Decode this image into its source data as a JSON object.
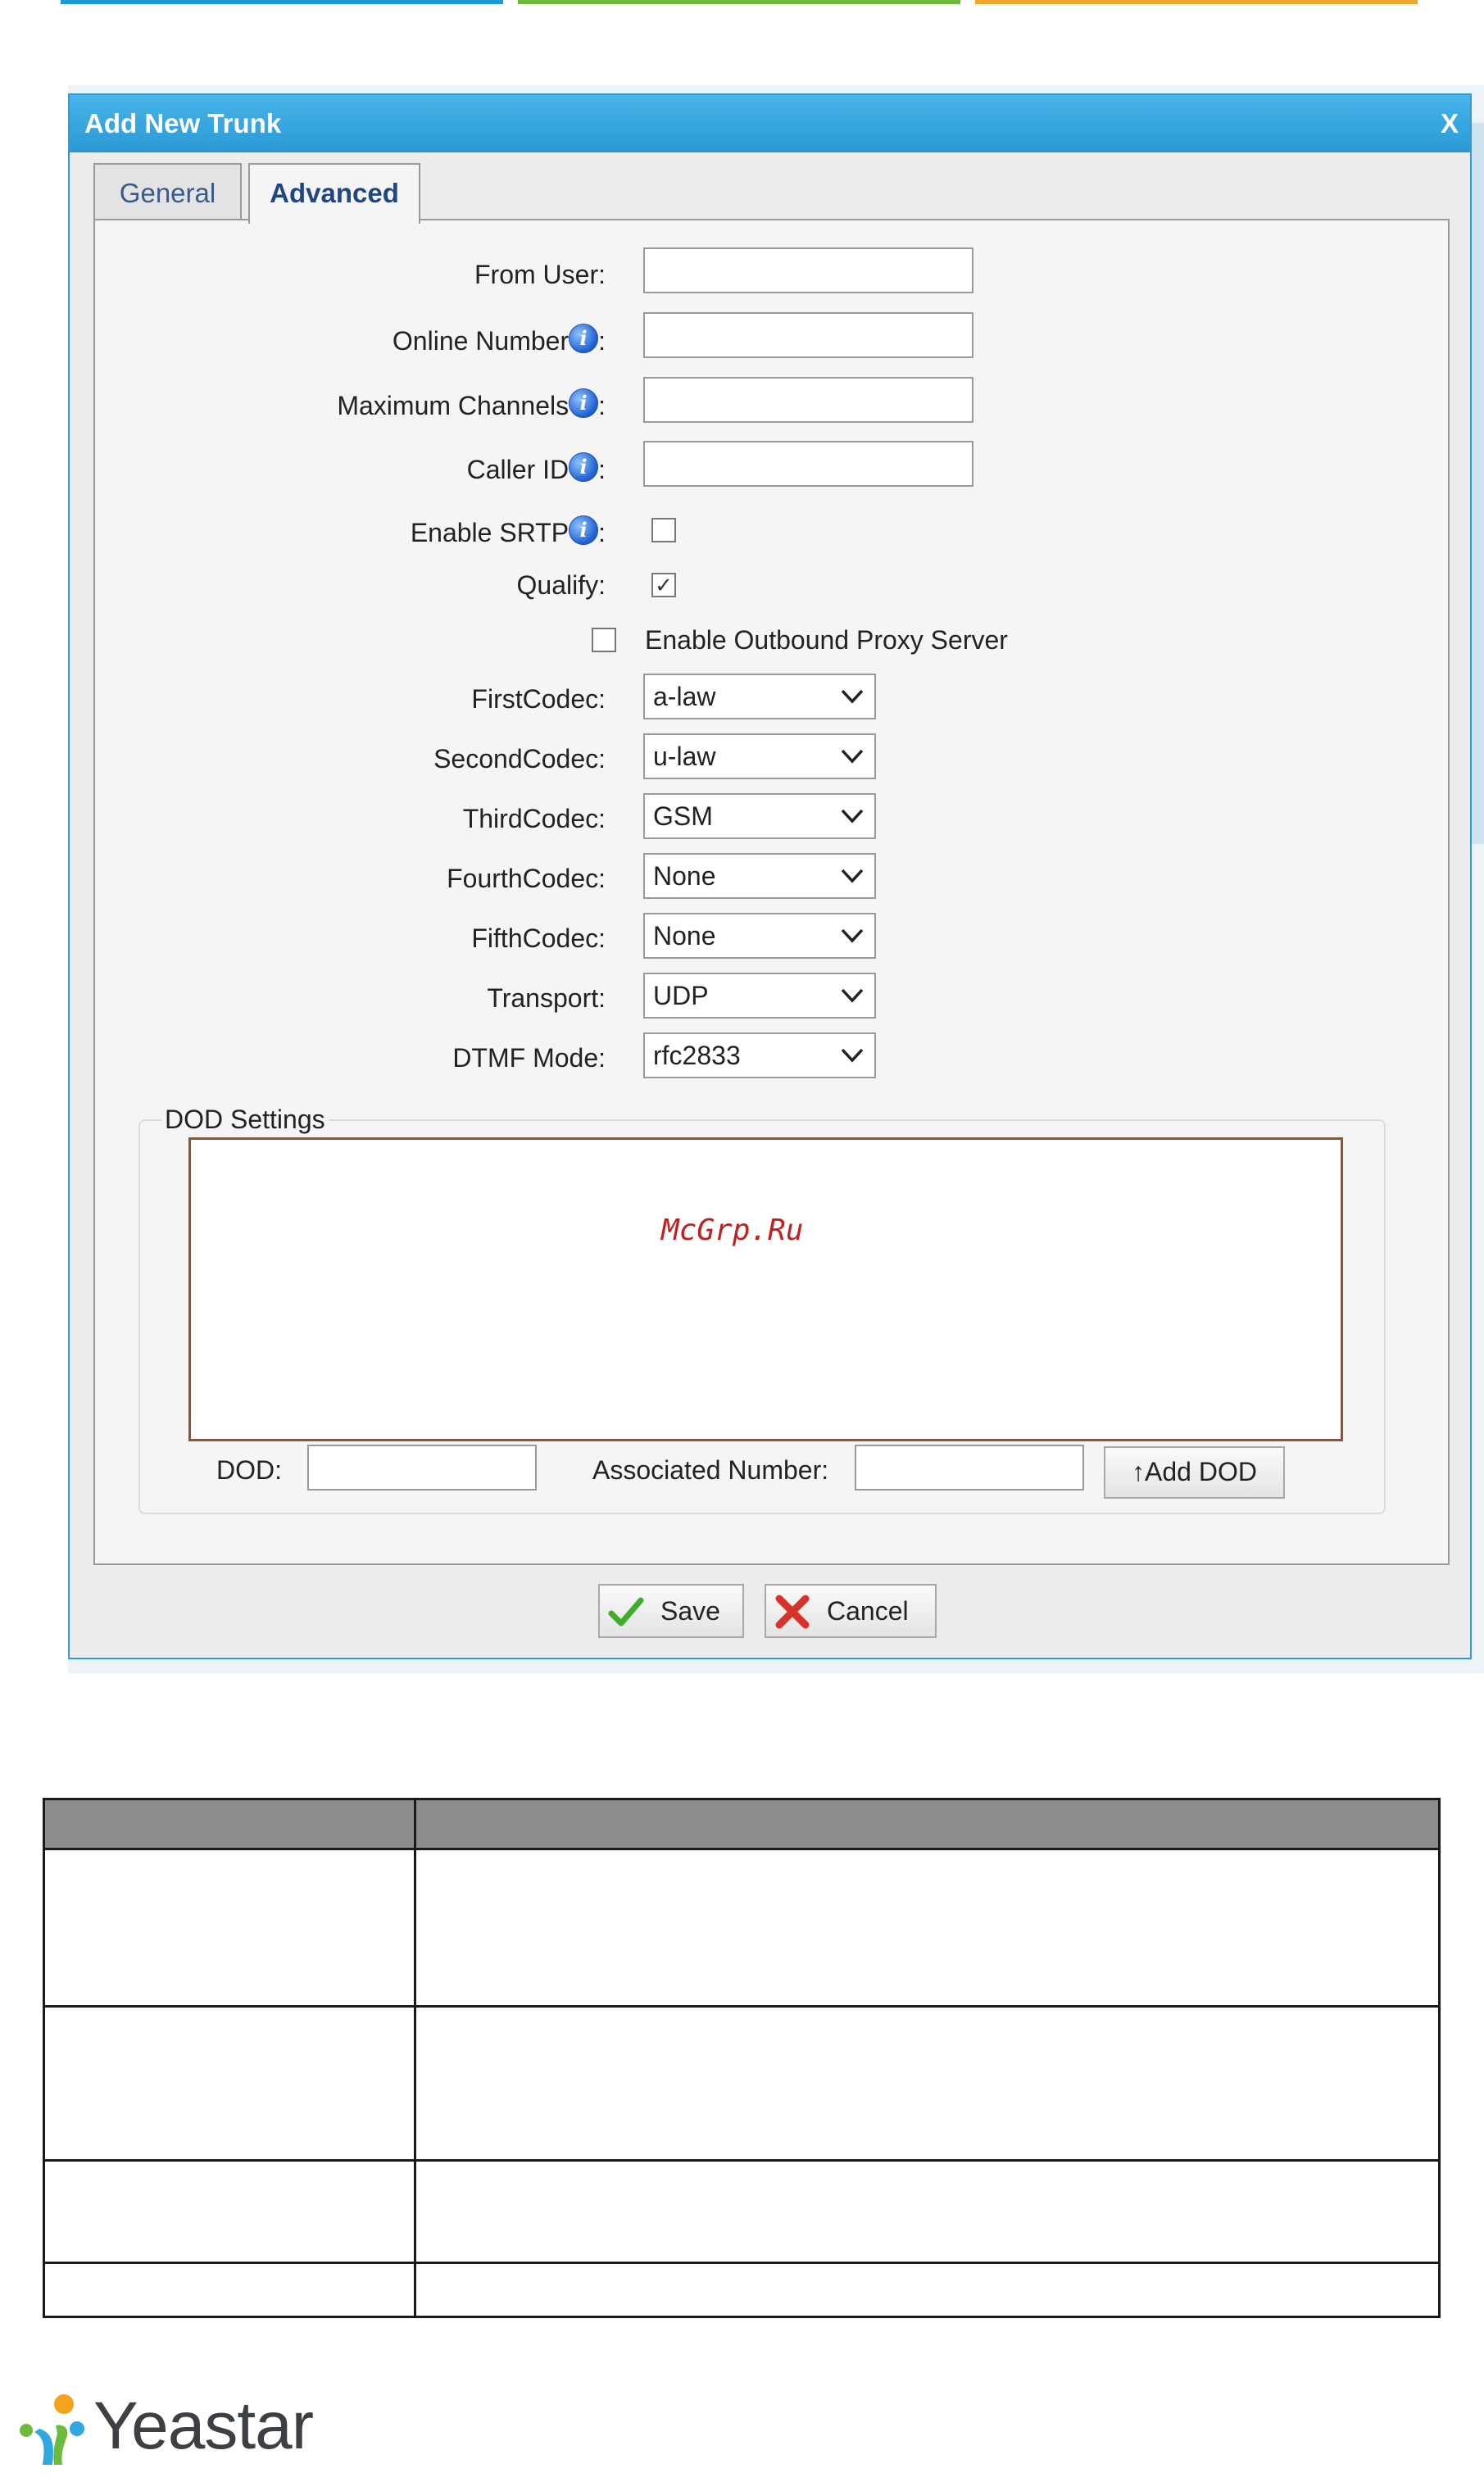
{
  "colors": {
    "strip_1": "#1b9ad6",
    "strip_2": "#6cbb3c",
    "strip_3": "#f3a529",
    "titlebar": "#3aa7df",
    "table_header": "#8c8c8c",
    "watermark": "#c41e1e"
  },
  "dialog": {
    "title": "Add New Trunk",
    "close_label": "X",
    "tabs": [
      {
        "label": "General",
        "active": false
      },
      {
        "label": "Advanced",
        "active": true
      }
    ],
    "fields": {
      "from_user": {
        "label": "From User:",
        "value": ""
      },
      "online_number": {
        "label": "Online Number",
        "suffix": ":",
        "value": "",
        "icon": "info-icon"
      },
      "max_channels": {
        "label": "Maximum Channels",
        "suffix": ":",
        "value": "",
        "icon": "info-icon"
      },
      "caller_id": {
        "label": "Caller ID",
        "suffix": ":",
        "value": "",
        "icon": "info-icon"
      },
      "enable_srtp": {
        "label": "Enable SRTP",
        "suffix": ":",
        "checked": false,
        "icon": "info-icon"
      },
      "qualify": {
        "label": "Qualify:",
        "checked": true
      },
      "outbound_proxy": {
        "label": "Enable Outbound Proxy Server",
        "checked": false
      },
      "first_codec": {
        "label": "FirstCodec:",
        "value": "a-law"
      },
      "second_codec": {
        "label": "SecondCodec:",
        "value": "u-law"
      },
      "third_codec": {
        "label": "ThirdCodec:",
        "value": "GSM"
      },
      "fourth_codec": {
        "label": "FourthCodec:",
        "value": "None"
      },
      "fifth_codec": {
        "label": "FifthCodec:",
        "value": "None"
      },
      "transport": {
        "label": "Transport:",
        "value": "UDP"
      },
      "dtmf_mode": {
        "label": "DTMF Mode:",
        "value": "rfc2833"
      }
    },
    "dod": {
      "legend": "DOD Settings",
      "watermark": "McGrp.Ru",
      "dod_label": "DOD:",
      "dod_value": "",
      "associated_label": "Associated Number:",
      "associated_value": "",
      "add_button": "↑Add DOD"
    },
    "buttons": {
      "save": "Save",
      "cancel": "Cancel"
    }
  },
  "table": {
    "header": [
      "",
      ""
    ],
    "rows": [
      [
        "",
        ""
      ],
      [
        "",
        ""
      ],
      [
        "",
        ""
      ],
      [
        "",
        ""
      ]
    ]
  },
  "logo": {
    "text": "Yeastar"
  }
}
